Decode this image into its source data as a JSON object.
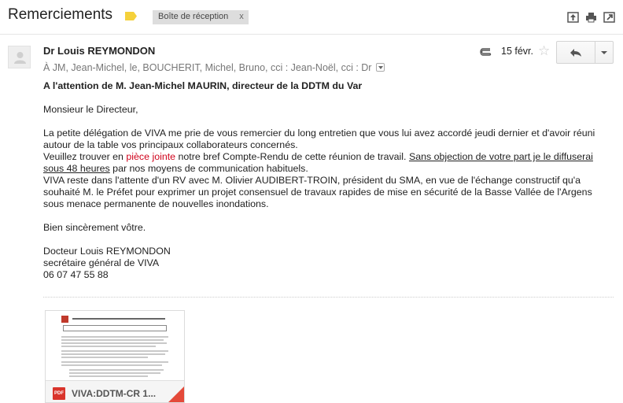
{
  "subject": "Remerciements",
  "label_chip": {
    "text": "Boîte de réception",
    "remove": "x"
  },
  "message": {
    "sender": "Dr Louis REYMONDON",
    "recipients": "À JM, Jean-Michel, le, BOUCHERIT, Michel, Bruno, cci : Jean-Noël, cci : Dr",
    "date": "15 févr.",
    "star": "☆"
  },
  "body": {
    "heading": "A l'attention de M. Jean-Michel MAURIN, directeur de la DDTM du Var",
    "salutation": "Monsieur le Directeur,",
    "p1": "La petite délégation de VIVA me prie de vous remercier du long entretien que vous lui avez accordé jeudi dernier et d'avoir réuni autour de la table vos principaux collaborateurs concernés.",
    "p2_pre": "Veuillez trouver en ",
    "p2_red": "pièce jointe",
    "p2_mid": " notre bref Compte-Rendu de cette réunion de travail. ",
    "p2_ul": "Sans objection de votre part je le diffuserai sous 48 heures",
    "p2_post": " par nos moyens de communication habituels.",
    "p3": "VIVA reste dans l'attente d'un RV avec M. Olivier AUDIBERT-TROIN, président du SMA, en vue de l'échange constructif qu'a souhaité M. le Préfet pour exprimer un projet consensuel de travaux rapides de mise en sécurité de la Basse Vallée de l'Argens sous menace permanente de nouvelles inondations.",
    "closing": "Bien sincèrement vôtre.",
    "sig_name": "Docteur Louis REYMONDON",
    "sig_title": "secrétaire général de VIVA",
    "sig_phone": "06 07 47 55 88"
  },
  "attachment": {
    "badge": "PDF",
    "name": "VIVA:DDTM-CR 1..."
  },
  "colors": {
    "label_tag": "#f5d13b",
    "link_red": "#d0021b",
    "pdf_red": "#d9342b"
  }
}
